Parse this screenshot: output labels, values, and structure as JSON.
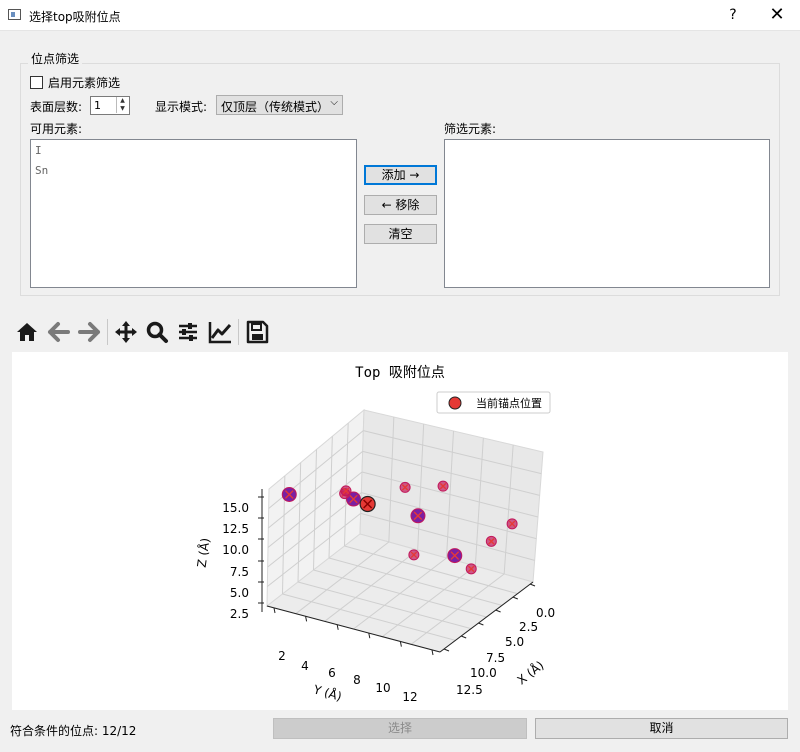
{
  "window": {
    "title": "选择top吸附位点",
    "help_label": "?",
    "close_label": "✕"
  },
  "filter": {
    "group_title": "位点筛选",
    "enable_label": "启用元素筛选",
    "enable_checked": false,
    "layers_label": "表面层数:",
    "layers_value": "1",
    "mode_label": "显示模式:",
    "mode_value": "仅顶层（传统模式）",
    "available_label": "可用元素:",
    "available_items": [
      "I",
      "Sn"
    ],
    "selected_label": "筛选元素:",
    "selected_items": [],
    "add_label": "添加 →",
    "remove_label": "← 移除",
    "clear_label": "清空"
  },
  "toolbar": {
    "icons": [
      "home-icon",
      "back-arrow-icon",
      "forward-arrow-icon",
      "pan-icon",
      "zoom-icon",
      "subplots-icon",
      "axes-edit-icon",
      "save-icon"
    ]
  },
  "chart_data": {
    "type": "scatter",
    "title": "Top 吸附位点",
    "legend": "当前锚点位置",
    "legend_placement": "top-right",
    "xlabel": "X (Å)",
    "ylabel": "Y (Å)",
    "zlabel": "Z (Å)",
    "x_ticks": [
      "0.0",
      "2.5",
      "5.0",
      "7.5",
      "10.0",
      "12.5"
    ],
    "y_ticks": [
      "2",
      "4",
      "6",
      "8",
      "10",
      "12"
    ],
    "z_ticks": [
      "2.5",
      "5.0",
      "7.5",
      "10.0",
      "12.5",
      "15.0"
    ],
    "xlim": [
      0,
      13
    ],
    "ylim": [
      1,
      13
    ],
    "zlim": [
      2,
      16
    ],
    "grid": true,
    "colors": {
      "site": "#c2185b",
      "anchor": "#e53935",
      "highlight": "#7b1fa2"
    }
  },
  "status": {
    "count_text": "符合条件的位点: 12/12",
    "select_label": "选择",
    "cancel_label": "取消"
  }
}
